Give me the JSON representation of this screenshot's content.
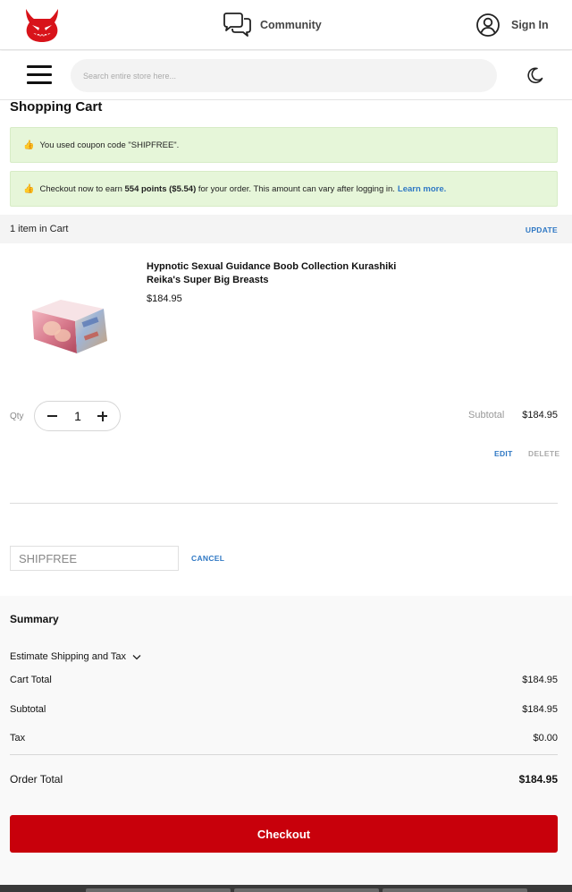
{
  "header": {
    "community_label": "Community",
    "signin_label": "Sign In"
  },
  "nav": {
    "search_placeholder": "Search entire store here..."
  },
  "page": {
    "title": "Shopping Cart"
  },
  "messages": {
    "coupon_used": "You used coupon code \"SHIPFREE\".",
    "points_pre": "Checkout now to earn ",
    "points_bold": "554 points ($5.54)",
    "points_post": " for your order. This amount can vary after logging in.",
    "learn_more": "Learn more."
  },
  "cart": {
    "count_label": "1 item in Cart",
    "update_label": "UPDATE",
    "item": {
      "name": "Hypnotic Sexual Guidance Boob Collection Kurashiki Reika's Super Big Breasts",
      "price": "$184.95",
      "qty_label": "Qty",
      "qty": "1",
      "subtotal_label": "Subtotal",
      "subtotal": "$184.95",
      "edit_label": "EDIT",
      "delete_label": "DELETE"
    }
  },
  "coupon": {
    "value": "SHIPFREE",
    "cancel_label": "CANCEL"
  },
  "summary": {
    "title": "Summary",
    "estimate_label": "Estimate Shipping and Tax",
    "cart_total_label": "Cart Total",
    "cart_total": "$184.95",
    "subtotal_label": "Subtotal",
    "subtotal": "$184.95",
    "tax_label": "Tax",
    "tax": "$0.00",
    "order_total_label": "Order Total",
    "order_total": "$184.95",
    "checkout_label": "Checkout"
  },
  "colors": {
    "brand_red": "#c8000b",
    "link_blue": "#2f78c4",
    "success_bg": "#e6f6d9"
  },
  "icons": [
    "devil-logo-icon",
    "chat-bubbles-icon",
    "user-circle-icon",
    "hamburger-menu-icon",
    "moon-icon",
    "thumbs-up-icon",
    "chevron-down-icon"
  ]
}
